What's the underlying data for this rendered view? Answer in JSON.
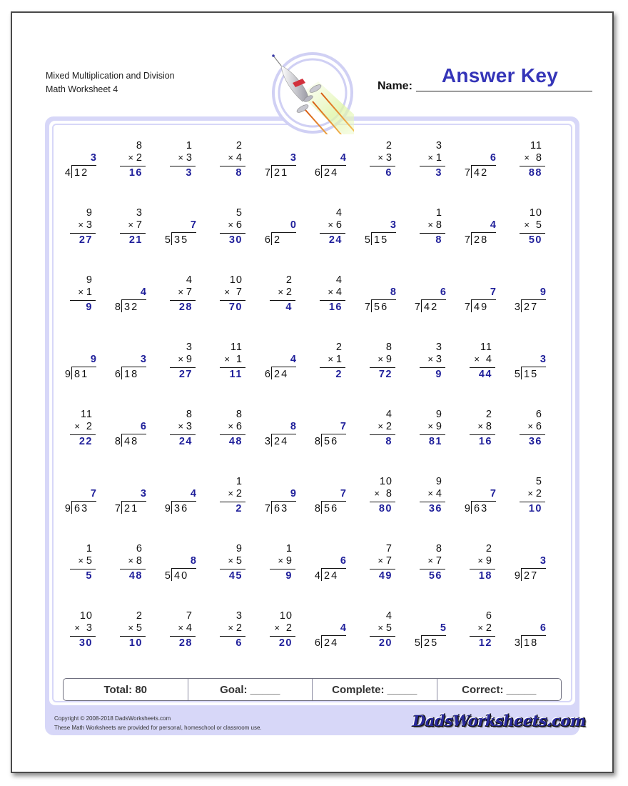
{
  "header": {
    "title_line1": "Mixed Multiplication and Division",
    "title_line2": "Math Worksheet 4",
    "name_label": "Name:",
    "name_value": "Answer Key"
  },
  "colors": {
    "answer": "#1f1f9a",
    "name_value": "#3535b8",
    "frame": "#d7d7f8"
  },
  "badge_icon": "rocket-icon",
  "problems": [
    [
      {
        "type": "div",
        "divisor": "4",
        "dividend": "12",
        "answer": "3"
      },
      {
        "type": "mul",
        "top": "8",
        "bottom": "2",
        "answer": "16"
      },
      {
        "type": "mul",
        "top": "1",
        "bottom": "3",
        "answer": "3"
      },
      {
        "type": "mul",
        "top": "2",
        "bottom": "4",
        "answer": "8"
      },
      {
        "type": "div",
        "divisor": "7",
        "dividend": "21",
        "answer": "3"
      },
      {
        "type": "div",
        "divisor": "6",
        "dividend": "24",
        "answer": "4"
      },
      {
        "type": "mul",
        "top": "2",
        "bottom": "3",
        "answer": "6"
      },
      {
        "type": "mul",
        "top": "3",
        "bottom": "1",
        "answer": "3"
      },
      {
        "type": "div",
        "divisor": "7",
        "dividend": "42",
        "answer": "6"
      },
      {
        "type": "mul",
        "top": "11",
        "bottom": " 8",
        "answer": "88"
      }
    ],
    [
      {
        "type": "mul",
        "top": "9",
        "bottom": "3",
        "answer": "27"
      },
      {
        "type": "mul",
        "top": "3",
        "bottom": "7",
        "answer": "21"
      },
      {
        "type": "div",
        "divisor": "5",
        "dividend": "35",
        "answer": "7"
      },
      {
        "type": "mul",
        "top": "5",
        "bottom": "6",
        "answer": "30"
      },
      {
        "type": "div",
        "divisor": "6",
        "dividend": "2",
        "answer": "0"
      },
      {
        "type": "mul",
        "top": "4",
        "bottom": "6",
        "answer": "24"
      },
      {
        "type": "div",
        "divisor": "5",
        "dividend": "15",
        "answer": "3"
      },
      {
        "type": "mul",
        "top": "1",
        "bottom": "8",
        "answer": "8"
      },
      {
        "type": "div",
        "divisor": "7",
        "dividend": "28",
        "answer": "4"
      },
      {
        "type": "mul",
        "top": "10",
        "bottom": " 5",
        "answer": "50"
      }
    ],
    [
      {
        "type": "mul",
        "top": "9",
        "bottom": "1",
        "answer": "9"
      },
      {
        "type": "div",
        "divisor": "8",
        "dividend": "32",
        "answer": "4"
      },
      {
        "type": "mul",
        "top": "4",
        "bottom": "7",
        "answer": "28"
      },
      {
        "type": "mul",
        "top": "10",
        "bottom": " 7",
        "answer": "70"
      },
      {
        "type": "mul",
        "top": "2",
        "bottom": "2",
        "answer": "4"
      },
      {
        "type": "mul",
        "top": "4",
        "bottom": "4",
        "answer": "16"
      },
      {
        "type": "div",
        "divisor": "7",
        "dividend": "56",
        "answer": "8"
      },
      {
        "type": "div",
        "divisor": "7",
        "dividend": "42",
        "answer": "6"
      },
      {
        "type": "div",
        "divisor": "7",
        "dividend": "49",
        "answer": "7"
      },
      {
        "type": "div",
        "divisor": "3",
        "dividend": "27",
        "answer": "9"
      }
    ],
    [
      {
        "type": "div",
        "divisor": "9",
        "dividend": "81",
        "answer": "9"
      },
      {
        "type": "div",
        "divisor": "6",
        "dividend": "18",
        "answer": "3"
      },
      {
        "type": "mul",
        "top": "3",
        "bottom": "9",
        "answer": "27"
      },
      {
        "type": "mul",
        "top": "11",
        "bottom": " 1",
        "answer": "11"
      },
      {
        "type": "div",
        "divisor": "6",
        "dividend": "24",
        "answer": "4"
      },
      {
        "type": "mul",
        "top": "2",
        "bottom": "1",
        "answer": "2"
      },
      {
        "type": "mul",
        "top": "8",
        "bottom": "9",
        "answer": "72"
      },
      {
        "type": "mul",
        "top": "3",
        "bottom": "3",
        "answer": "9"
      },
      {
        "type": "mul",
        "top": "11",
        "bottom": " 4",
        "answer": "44"
      },
      {
        "type": "div",
        "divisor": "5",
        "dividend": "15",
        "answer": "3"
      }
    ],
    [
      {
        "type": "mul",
        "top": "11",
        "bottom": " 2",
        "answer": "22"
      },
      {
        "type": "div",
        "divisor": "8",
        "dividend": "48",
        "answer": "6"
      },
      {
        "type": "mul",
        "top": "8",
        "bottom": "3",
        "answer": "24"
      },
      {
        "type": "mul",
        "top": "8",
        "bottom": "6",
        "answer": "48"
      },
      {
        "type": "div",
        "divisor": "3",
        "dividend": "24",
        "answer": "8"
      },
      {
        "type": "div",
        "divisor": "8",
        "dividend": "56",
        "answer": "7"
      },
      {
        "type": "mul",
        "top": "4",
        "bottom": "2",
        "answer": "8"
      },
      {
        "type": "mul",
        "top": "9",
        "bottom": "9",
        "answer": "81"
      },
      {
        "type": "mul",
        "top": "2",
        "bottom": "8",
        "answer": "16"
      },
      {
        "type": "mul",
        "top": "6",
        "bottom": "6",
        "answer": "36"
      }
    ],
    [
      {
        "type": "div",
        "divisor": "9",
        "dividend": "63",
        "answer": "7"
      },
      {
        "type": "div",
        "divisor": "7",
        "dividend": "21",
        "answer": "3"
      },
      {
        "type": "div",
        "divisor": "9",
        "dividend": "36",
        "answer": "4"
      },
      {
        "type": "mul",
        "top": "1",
        "bottom": "2",
        "answer": "2"
      },
      {
        "type": "div",
        "divisor": "7",
        "dividend": "63",
        "answer": "9"
      },
      {
        "type": "div",
        "divisor": "8",
        "dividend": "56",
        "answer": "7"
      },
      {
        "type": "mul",
        "top": "10",
        "bottom": " 8",
        "answer": "80"
      },
      {
        "type": "mul",
        "top": "9",
        "bottom": "4",
        "answer": "36"
      },
      {
        "type": "div",
        "divisor": "9",
        "dividend": "63",
        "answer": "7"
      },
      {
        "type": "mul",
        "top": "5",
        "bottom": "2",
        "answer": "10"
      }
    ],
    [
      {
        "type": "mul",
        "top": "1",
        "bottom": "5",
        "answer": "5"
      },
      {
        "type": "mul",
        "top": "6",
        "bottom": "8",
        "answer": "48"
      },
      {
        "type": "div",
        "divisor": "5",
        "dividend": "40",
        "answer": "8"
      },
      {
        "type": "mul",
        "top": "9",
        "bottom": "5",
        "answer": "45"
      },
      {
        "type": "mul",
        "top": "1",
        "bottom": "9",
        "answer": "9"
      },
      {
        "type": "div",
        "divisor": "4",
        "dividend": "24",
        "answer": "6"
      },
      {
        "type": "mul",
        "top": "7",
        "bottom": "7",
        "answer": "49"
      },
      {
        "type": "mul",
        "top": "8",
        "bottom": "7",
        "answer": "56"
      },
      {
        "type": "mul",
        "top": "2",
        "bottom": "9",
        "answer": "18"
      },
      {
        "type": "div",
        "divisor": "9",
        "dividend": "27",
        "answer": "3"
      }
    ],
    [
      {
        "type": "mul",
        "top": "10",
        "bottom": " 3",
        "answer": "30"
      },
      {
        "type": "mul",
        "top": "2",
        "bottom": "5",
        "answer": "10"
      },
      {
        "type": "mul",
        "top": "7",
        "bottom": "4",
        "answer": "28"
      },
      {
        "type": "mul",
        "top": "3",
        "bottom": "2",
        "answer": "6"
      },
      {
        "type": "mul",
        "top": "10",
        "bottom": " 2",
        "answer": "20"
      },
      {
        "type": "div",
        "divisor": "6",
        "dividend": "24",
        "answer": "4"
      },
      {
        "type": "mul",
        "top": "4",
        "bottom": "5",
        "answer": "20"
      },
      {
        "type": "div",
        "divisor": "5",
        "dividend": "25",
        "answer": "5"
      },
      {
        "type": "mul",
        "top": "6",
        "bottom": "2",
        "answer": "12"
      },
      {
        "type": "div",
        "divisor": "3",
        "dividend": "18",
        "answer": "6"
      }
    ]
  ],
  "operator_symbol": "×",
  "totals": {
    "total": "Total: 80",
    "goal": "Goal: _____",
    "complete": "Complete: _____",
    "correct": "Correct: _____"
  },
  "footer": {
    "copyright": "Copyright © 2008-2018 DadsWorksheets.com",
    "usage": "These Math Worksheets are provided for personal, homeschool or classroom use.",
    "brand": "DadsWorksheets.com"
  }
}
